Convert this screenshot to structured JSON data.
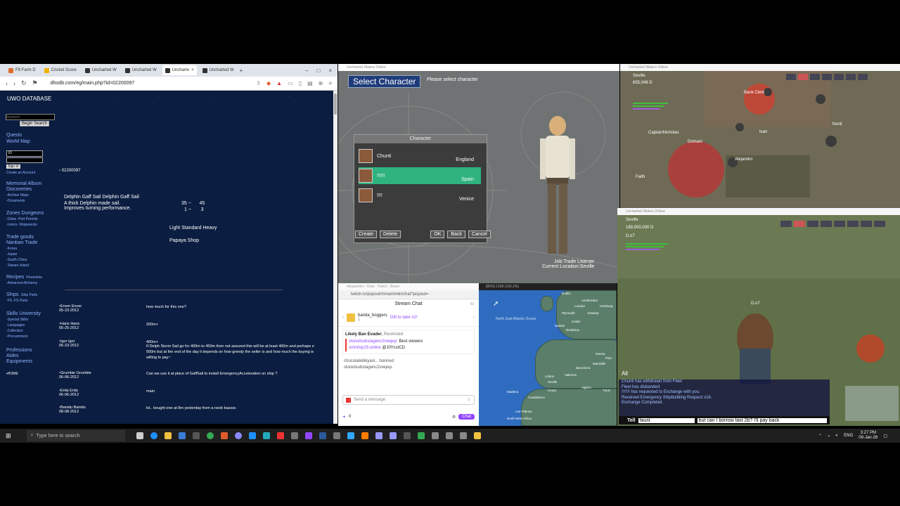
{
  "browser": {
    "tabs": [
      {
        "label": "F9 Farm D"
      },
      {
        "label": "Cricket Score"
      },
      {
        "label": "Uncharted W"
      },
      {
        "label": "Uncharted W"
      },
      {
        "label": "Uncharte"
      },
      {
        "label": "Uncharted W"
      }
    ],
    "url": "dhodb.com/eg/main.php?id=02200097",
    "page": {
      "title": "UWO DATABASE",
      "keyword_placeholder": "keyword",
      "search_button": "Begin Search",
      "nav1": [
        "Quests",
        "World Map"
      ],
      "id_label": "ID",
      "signin": "Sign In",
      "create_account": "Create an Account",
      "nav2": [
        "Memorial Album",
        "Discoveries",
        "-Archive Maps",
        "-Ornaments"
      ],
      "nav3": [
        "Zones Dungeons",
        "-Cities -Port Permits",
        "-Liners -Shipwrecks"
      ],
      "nav4": [
        "Trade goods",
        "Nanban Trade",
        "-Korea",
        "-Japan",
        "-South China",
        "-Taiwan Island"
      ],
      "recipes": "Recipes",
      "recipes_sub": "-Florentine",
      "recipes_sub2": "-Advanced Alchemy",
      "ships": "Ships",
      "ships_sub": "-Ship Parts",
      "ships_sub2": "-FS -FS Parts",
      "skills": "Skills University",
      "skills_subs": [
        "-Special Skills",
        "-Languages",
        "-Collection",
        "-Procurement"
      ],
      "professions": [
        "Professions",
        "Aides",
        "Equipments"
      ],
      "home": "HOME",
      "item_id": "02200097",
      "item_name": "Delphin Gaff Sail Delphin Gaff Sail",
      "item_desc1": "A thick Delphin made sail.",
      "item_desc2": "Improves turning performance.",
      "stat1a": "35",
      "stat1b": "45",
      "stat2a": "1",
      "stat2b": "3",
      "stat_sep": "~",
      "class_label": "Light Standard Heavy",
      "shop": "Papaya Shop",
      "comments": [
        {
          "user": "Enver Enver",
          "date": "05-23-2012",
          "text": "how much for this one?"
        },
        {
          "user": "Hans Hans",
          "date": "05-25-2012",
          "text": "200m+"
        },
        {
          "user": "Igor Igor",
          "date": "05-23-2012",
          "text": "400m+"
        },
        {
          "user": "Grumbie Grumbie",
          "date": "06-06-2012",
          "text": "Can we use it at place of GaffSail to install EmergencyAcceleration on ship ?"
        },
        {
          "user": "Erda Erda",
          "date": "06-06-2012",
          "text": "main"
        },
        {
          "user": "Banidu Banidu",
          "date": "08-08-2012",
          "text": "lol.. bought one at 8m yesterday from a noob bazzar."
        }
      ],
      "igor_extra1": "If Delph Storm Sail go for 400m to 450m then not assured this will be at least 400m and perhaps e",
      "igor_extra2": "500m but at the end of the day it depends on how greedy the seller is and how much the buying is",
      "igor_extra3": "willing to pay~"
    }
  },
  "charsel": {
    "window_title": "Uncharted Waters Online",
    "heading": "Select Character",
    "subheading": "Please select character",
    "panel_title": "Character",
    "characters": [
      {
        "name": "Chunti",
        "nation": "England"
      },
      {
        "name": "!!!!!!",
        "nation": "Spain"
      },
      {
        "name": "!!!!",
        "nation": "Venice"
      }
    ],
    "buttons": {
      "create": "Create",
      "delete": "Delete",
      "ok": "OK",
      "back": "Back",
      "cancel": "Cancel"
    },
    "job": "Job:Trade Learner",
    "location": "Current Location:Seville"
  },
  "game1": {
    "window_title": "Uncharted Waters Online",
    "city": "Seville",
    "ducats": "655,046",
    "ducat_sign": "D",
    "names": [
      "Bank Clerk",
      "Kenil",
      "CaptainNicholas",
      "Domani",
      "Ivan",
      "Alejandro",
      "Faith"
    ]
  },
  "game2": {
    "window_title": "Uncharted Waters Online",
    "city": "Seville",
    "ducats": "189,500,000",
    "ducat_sign": "D",
    "player": "D.o7",
    "player_tag": "D.o7",
    "chat_tab": "All",
    "chat": [
      "Chunti has withdrawn from Fleet",
      "Fleet has disbanded",
      "!!!!!!! has requested to Exchange with you.",
      "Received Emergency Shipbuilding Request x16.",
      "Exchange Completed."
    ],
    "tell_label": "Tell",
    "tell_target": "faust",
    "tell_text": "but can I borrow last 2b? I'll pay back"
  },
  "chat": {
    "window_title": "minamimin - Chat - Twitch - Brave",
    "url": "twitch.tv/popout/minamimin/chat?popout=",
    "header": "Stream Chat",
    "gift_user": "banda_boggers",
    "gift_count": "1",
    "gift_label": "Gift to take #2!",
    "mod_title": "Likely Ban Evader",
    "mod_status": "Restricted",
    "mod_user": "storedsubstagenc2vwqep",
    "mod_text": "Best viewers",
    "mod_link": "smmtop29.online",
    "mod_code": "@J0YcstCD",
    "ban_line1": "chocolatebikyani... banned",
    "ban_line2": "storedsubstagenc2vwqep.",
    "input_placeholder": "Send a message",
    "points": "0",
    "chat_button": "Chat"
  },
  "map": {
    "window_title": "[85%] 1258 (100.2%)",
    "ocean": "North East Atlantic Ocean",
    "cities": [
      "Dublin",
      "Amsterdam",
      "London",
      "Hamburg",
      "Plymouth",
      "Antwerp",
      "Calais",
      "Bordeaux",
      "Nantes",
      "Lisbon",
      "Seville",
      "Valencia",
      "Barcelona",
      "Marseille",
      "Genoa",
      "Pisa",
      "Algiers",
      "Tunis",
      "Madeira",
      "Ceuta",
      "Casablanca",
      "Las Palmas",
      "North West Africa"
    ]
  },
  "taskbar": {
    "search_placeholder": "Type here to search",
    "time": "3:27 PM",
    "date": "09-Jan-26",
    "lang": "ENG"
  }
}
